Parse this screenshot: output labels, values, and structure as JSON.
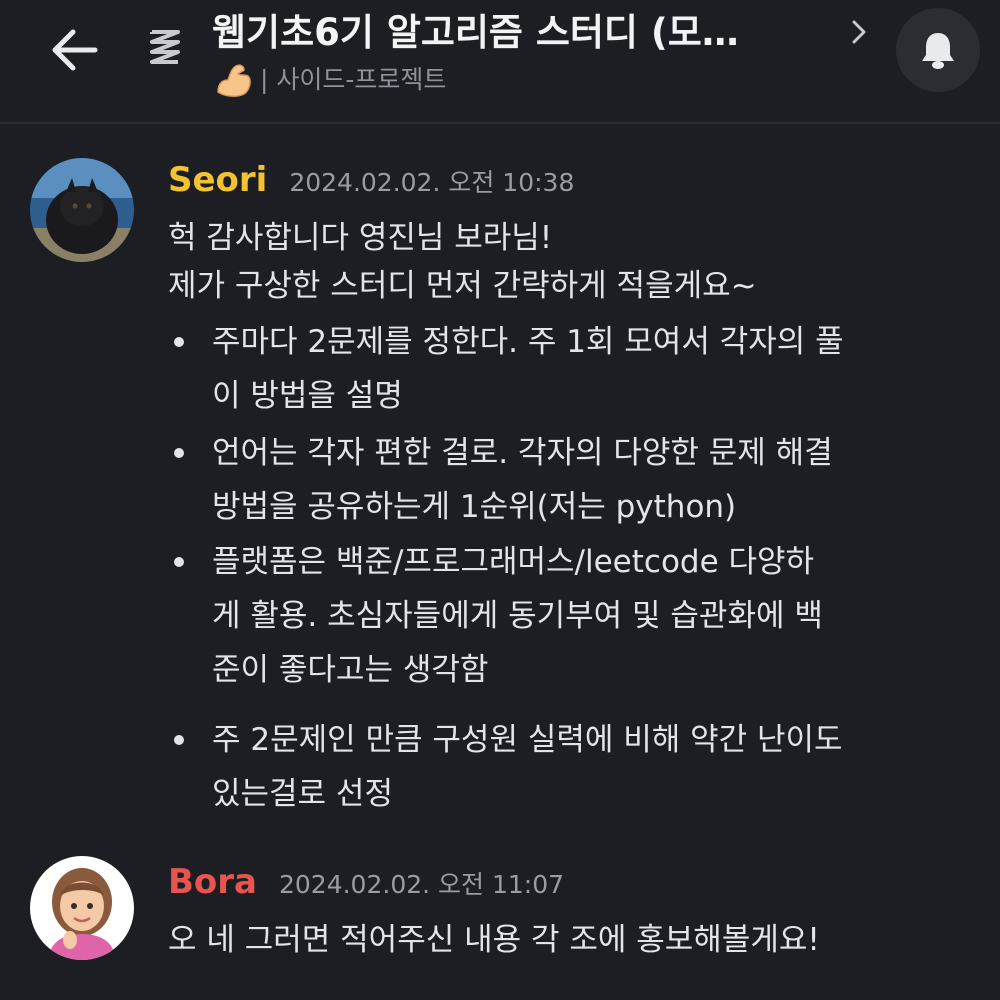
{
  "header": {
    "back_icon": "arrow-left-icon",
    "thread_icon": "thread-icon",
    "title": "웹기초6기 알고리즘 스터디 (모…",
    "subtitle_emoji": "flexed-biceps-emoji",
    "subtitle": "| 사이드-프로젝트",
    "chevron_icon": "chevron-right-icon",
    "bell_icon": "bell-icon"
  },
  "messages": [
    {
      "author": "Seori",
      "author_color": "#f2c230",
      "timestamp": "2024.02.02. 오전 10:38",
      "lines": [
        "헉 감사합니다 영진님 보라님!",
        "제가 구상한 스터디 먼저 간략하게 적을게요~"
      ],
      "bullets": [
        [
          "주마다 2문제를 정한다. 주 1회 모여서 각자의 풀",
          "이 방법을 설명"
        ],
        [
          "언어는 각자 편한 걸로. 각자의 다양한 문제 해결",
          "방법을 공유하는게 1순위(저는 python)"
        ],
        [
          "플랫폼은 백준/프로그래머스/leetcode 다양하",
          "게 활용. 초심자들에게 동기부여 및 습관화에 백",
          "준이 좋다고는 생각함"
        ],
        [
          "주 2문제인 만큼 구성원 실력에 비해 약간 난이도",
          "있는걸로 선정"
        ]
      ]
    },
    {
      "author": "Bora",
      "author_color": "#e8554e",
      "timestamp": "2024.02.02. 오전 11:07",
      "lines": [
        "오 네 그러면 적어주신 내용 각 조에 홍보해볼게요!"
      ]
    }
  ]
}
